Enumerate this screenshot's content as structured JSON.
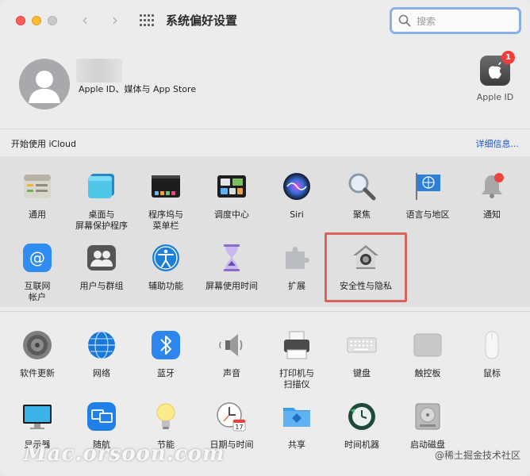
{
  "window": {
    "title": "系统偏好设置"
  },
  "search": {
    "placeholder": "搜索"
  },
  "account": {
    "subtitle": "Apple ID、媒体与 App Store",
    "appleid_label": "Apple ID",
    "badge_count": "1"
  },
  "icloud": {
    "left_text": "开始使用 iCloud",
    "right_link": "详细信息..."
  },
  "row1": [
    {
      "label": "通用"
    },
    {
      "label": "桌面与\n屏幕保护程序"
    },
    {
      "label": "程序坞与\n菜单栏"
    },
    {
      "label": "调度中心"
    },
    {
      "label": "Siri"
    },
    {
      "label": "聚焦"
    },
    {
      "label": "语言与地区"
    },
    {
      "label": "通知"
    }
  ],
  "row2": [
    {
      "label": "互联网\n帐户"
    },
    {
      "label": "用户与群组"
    },
    {
      "label": "辅助功能"
    },
    {
      "label": "屏幕使用时间"
    },
    {
      "label": "扩展"
    },
    {
      "label": "安全性与隐私"
    }
  ],
  "row3": [
    {
      "label": "软件更新"
    },
    {
      "label": "网络"
    },
    {
      "label": "蓝牙"
    },
    {
      "label": "声音"
    },
    {
      "label": "打印机与\n扫描仪"
    },
    {
      "label": "键盘"
    },
    {
      "label": "触控板"
    },
    {
      "label": "鼠标"
    }
  ],
  "row4": [
    {
      "label": "显示器"
    },
    {
      "label": "随航"
    },
    {
      "label": "节能"
    },
    {
      "label": "日期与时间"
    },
    {
      "label": "共享"
    },
    {
      "label": "时间机器"
    },
    {
      "label": "启动磁盘"
    }
  ],
  "calendar_day": "17",
  "watermark": "Mac.orsoon.com",
  "credit": "@稀土掘金技术社区"
}
